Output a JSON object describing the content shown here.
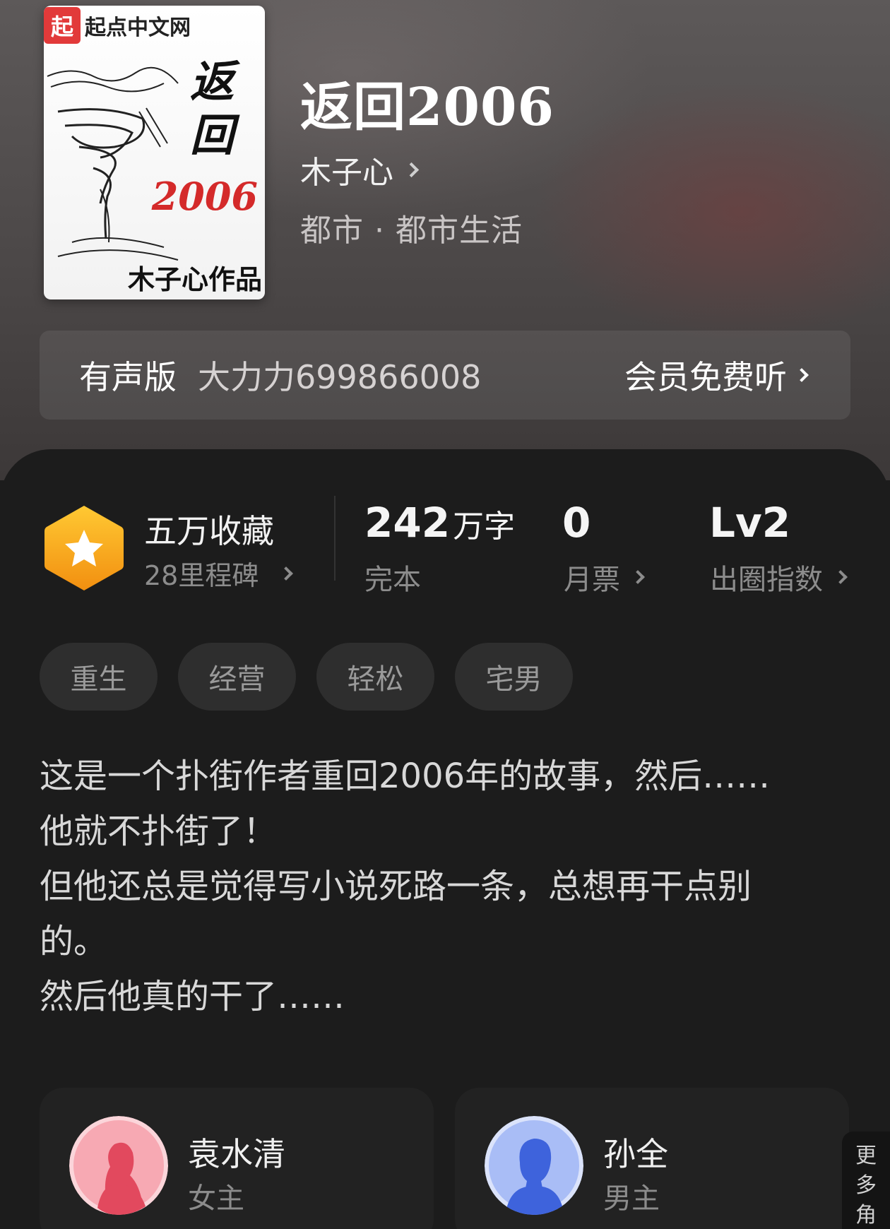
{
  "cover": {
    "publisher": "起点中文网",
    "publisher_badge": "起",
    "title_chars": [
      "返",
      "回"
    ],
    "year": "2006",
    "author_credit": "木子心作品"
  },
  "book": {
    "title": "返回2006",
    "author": "木子心",
    "genre": "都市 · 都市生活"
  },
  "audio": {
    "label": "有声版",
    "narrator": "大力力699866008",
    "cta": "会员免费听"
  },
  "stats": {
    "favorites": "五万收藏",
    "milestones": "28里程碑",
    "word_count_number": "242",
    "word_count_unit": "万字",
    "status": "完本",
    "monthly_votes": "0",
    "monthly_votes_label": "月票",
    "level": "Lv2",
    "level_label": "出圈指数"
  },
  "tags": [
    "重生",
    "经营",
    "轻松",
    "宅男"
  ],
  "intro": [
    "这是一个扑街作者重回2006年的故事，然后……",
    "他就不扑街了！",
    "但他还总是觉得写小说死路一条，总想再干点别",
    "的。",
    "然后他真的干了……"
  ],
  "characters": [
    {
      "name": "袁水清",
      "role": "女主",
      "avatar_color": "#f07c8a"
    },
    {
      "name": "孙全",
      "role": "男主",
      "avatar_color": "#6f8ef0"
    }
  ],
  "more_tab": [
    "更",
    "多",
    "角"
  ],
  "colors": {
    "panel_bg": "#1c1c1c",
    "badge_gold": "#f7a81b",
    "tag_bg": "#2e2e2e"
  }
}
